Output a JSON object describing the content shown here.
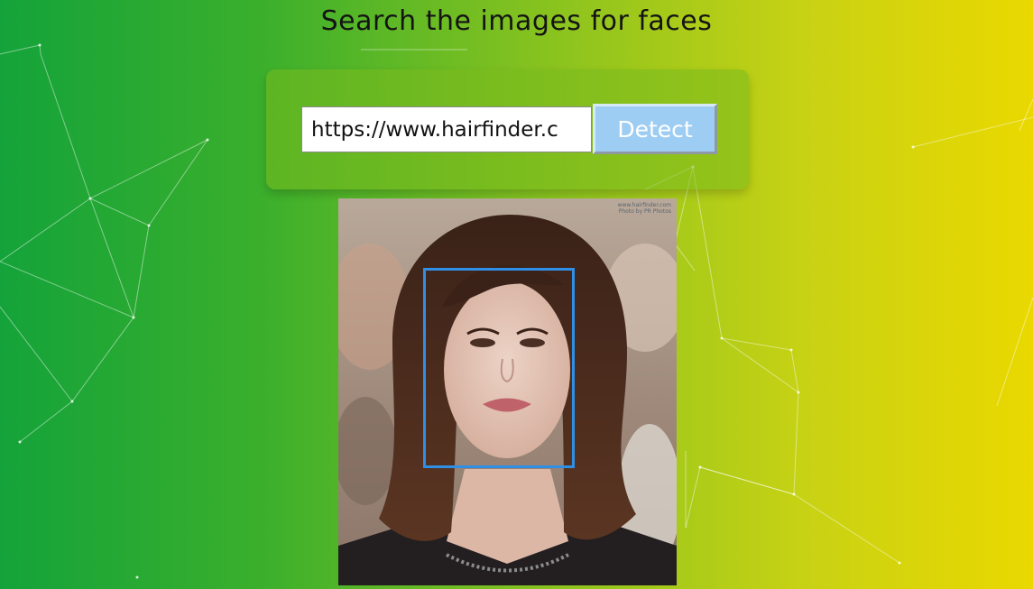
{
  "page": {
    "title": "Search the images for faces"
  },
  "form": {
    "url_value": "https://www.hairfinder.c",
    "detect_label": "Detect"
  },
  "result": {
    "watermark_line1": "www.hairfinder.com",
    "watermark_line2": "Photo by PR Photos",
    "detected_faces": 1
  },
  "colors": {
    "gradient_left": "#14a33a",
    "gradient_right": "#ead800",
    "button_bg": "#9ecdf3",
    "face_box": "#2f8fe6"
  }
}
